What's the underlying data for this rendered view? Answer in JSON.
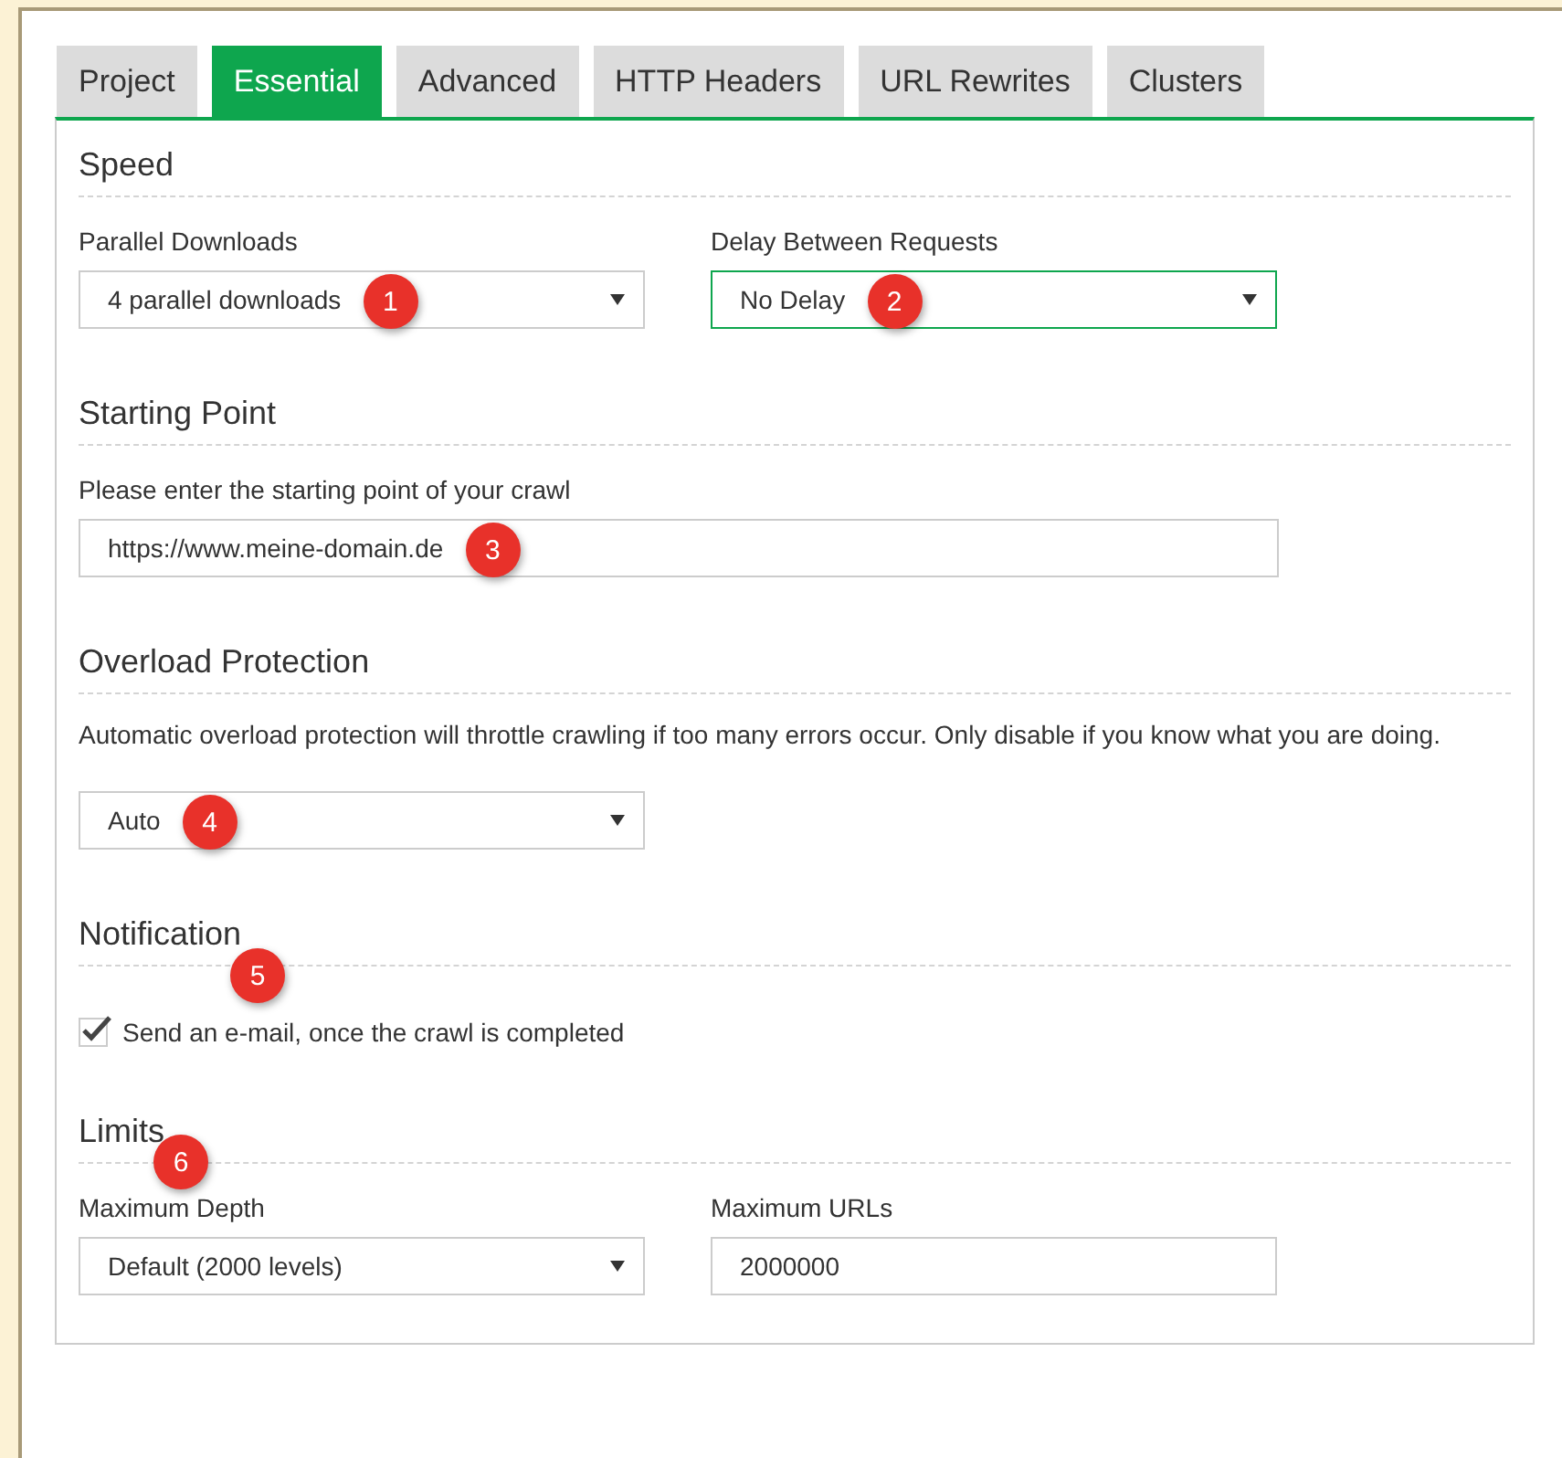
{
  "tabs": [
    {
      "label": "Project",
      "selected": false
    },
    {
      "label": "Essential",
      "selected": true
    },
    {
      "label": "Advanced",
      "selected": false
    },
    {
      "label": "HTTP Headers",
      "selected": false
    },
    {
      "label": "URL Rewrites",
      "selected": false
    },
    {
      "label": "Clusters",
      "selected": false
    }
  ],
  "sections": [
    {
      "title": "Speed",
      "fields": [
        {
          "kind": "select",
          "label": "Parallel Downloads",
          "value": "4 parallel downloads",
          "focused": false,
          "badge": "1"
        },
        {
          "kind": "select",
          "label": "Delay Between Requests",
          "value": "No Delay",
          "focused": true,
          "badge": "2"
        }
      ]
    },
    {
      "title": "Starting Point",
      "fields": [
        {
          "kind": "text",
          "label": "Please enter the starting point of your crawl",
          "value": "https://www.meine-domain.de",
          "focused": false,
          "badge": "3"
        }
      ]
    },
    {
      "title": "Overload Protection",
      "description": "Automatic overload protection will throttle crawling if too many errors occur. Only disable if you know what you are doing.",
      "fields": [
        {
          "kind": "select",
          "value": "Auto",
          "focused": false,
          "badge": "4"
        }
      ]
    },
    {
      "title": "Notification",
      "badge": "5",
      "fields": [
        {
          "kind": "checkbox",
          "label": "Send an e-mail, once the crawl is completed",
          "checked": true
        }
      ]
    },
    {
      "title": "Limits",
      "badge": "6",
      "fields": [
        {
          "kind": "select",
          "label": "Maximum Depth",
          "value": "Default (2000 levels)",
          "focused": false
        },
        {
          "kind": "text",
          "label": "Maximum URLs",
          "value": "2000000",
          "focused": false
        }
      ]
    }
  ]
}
